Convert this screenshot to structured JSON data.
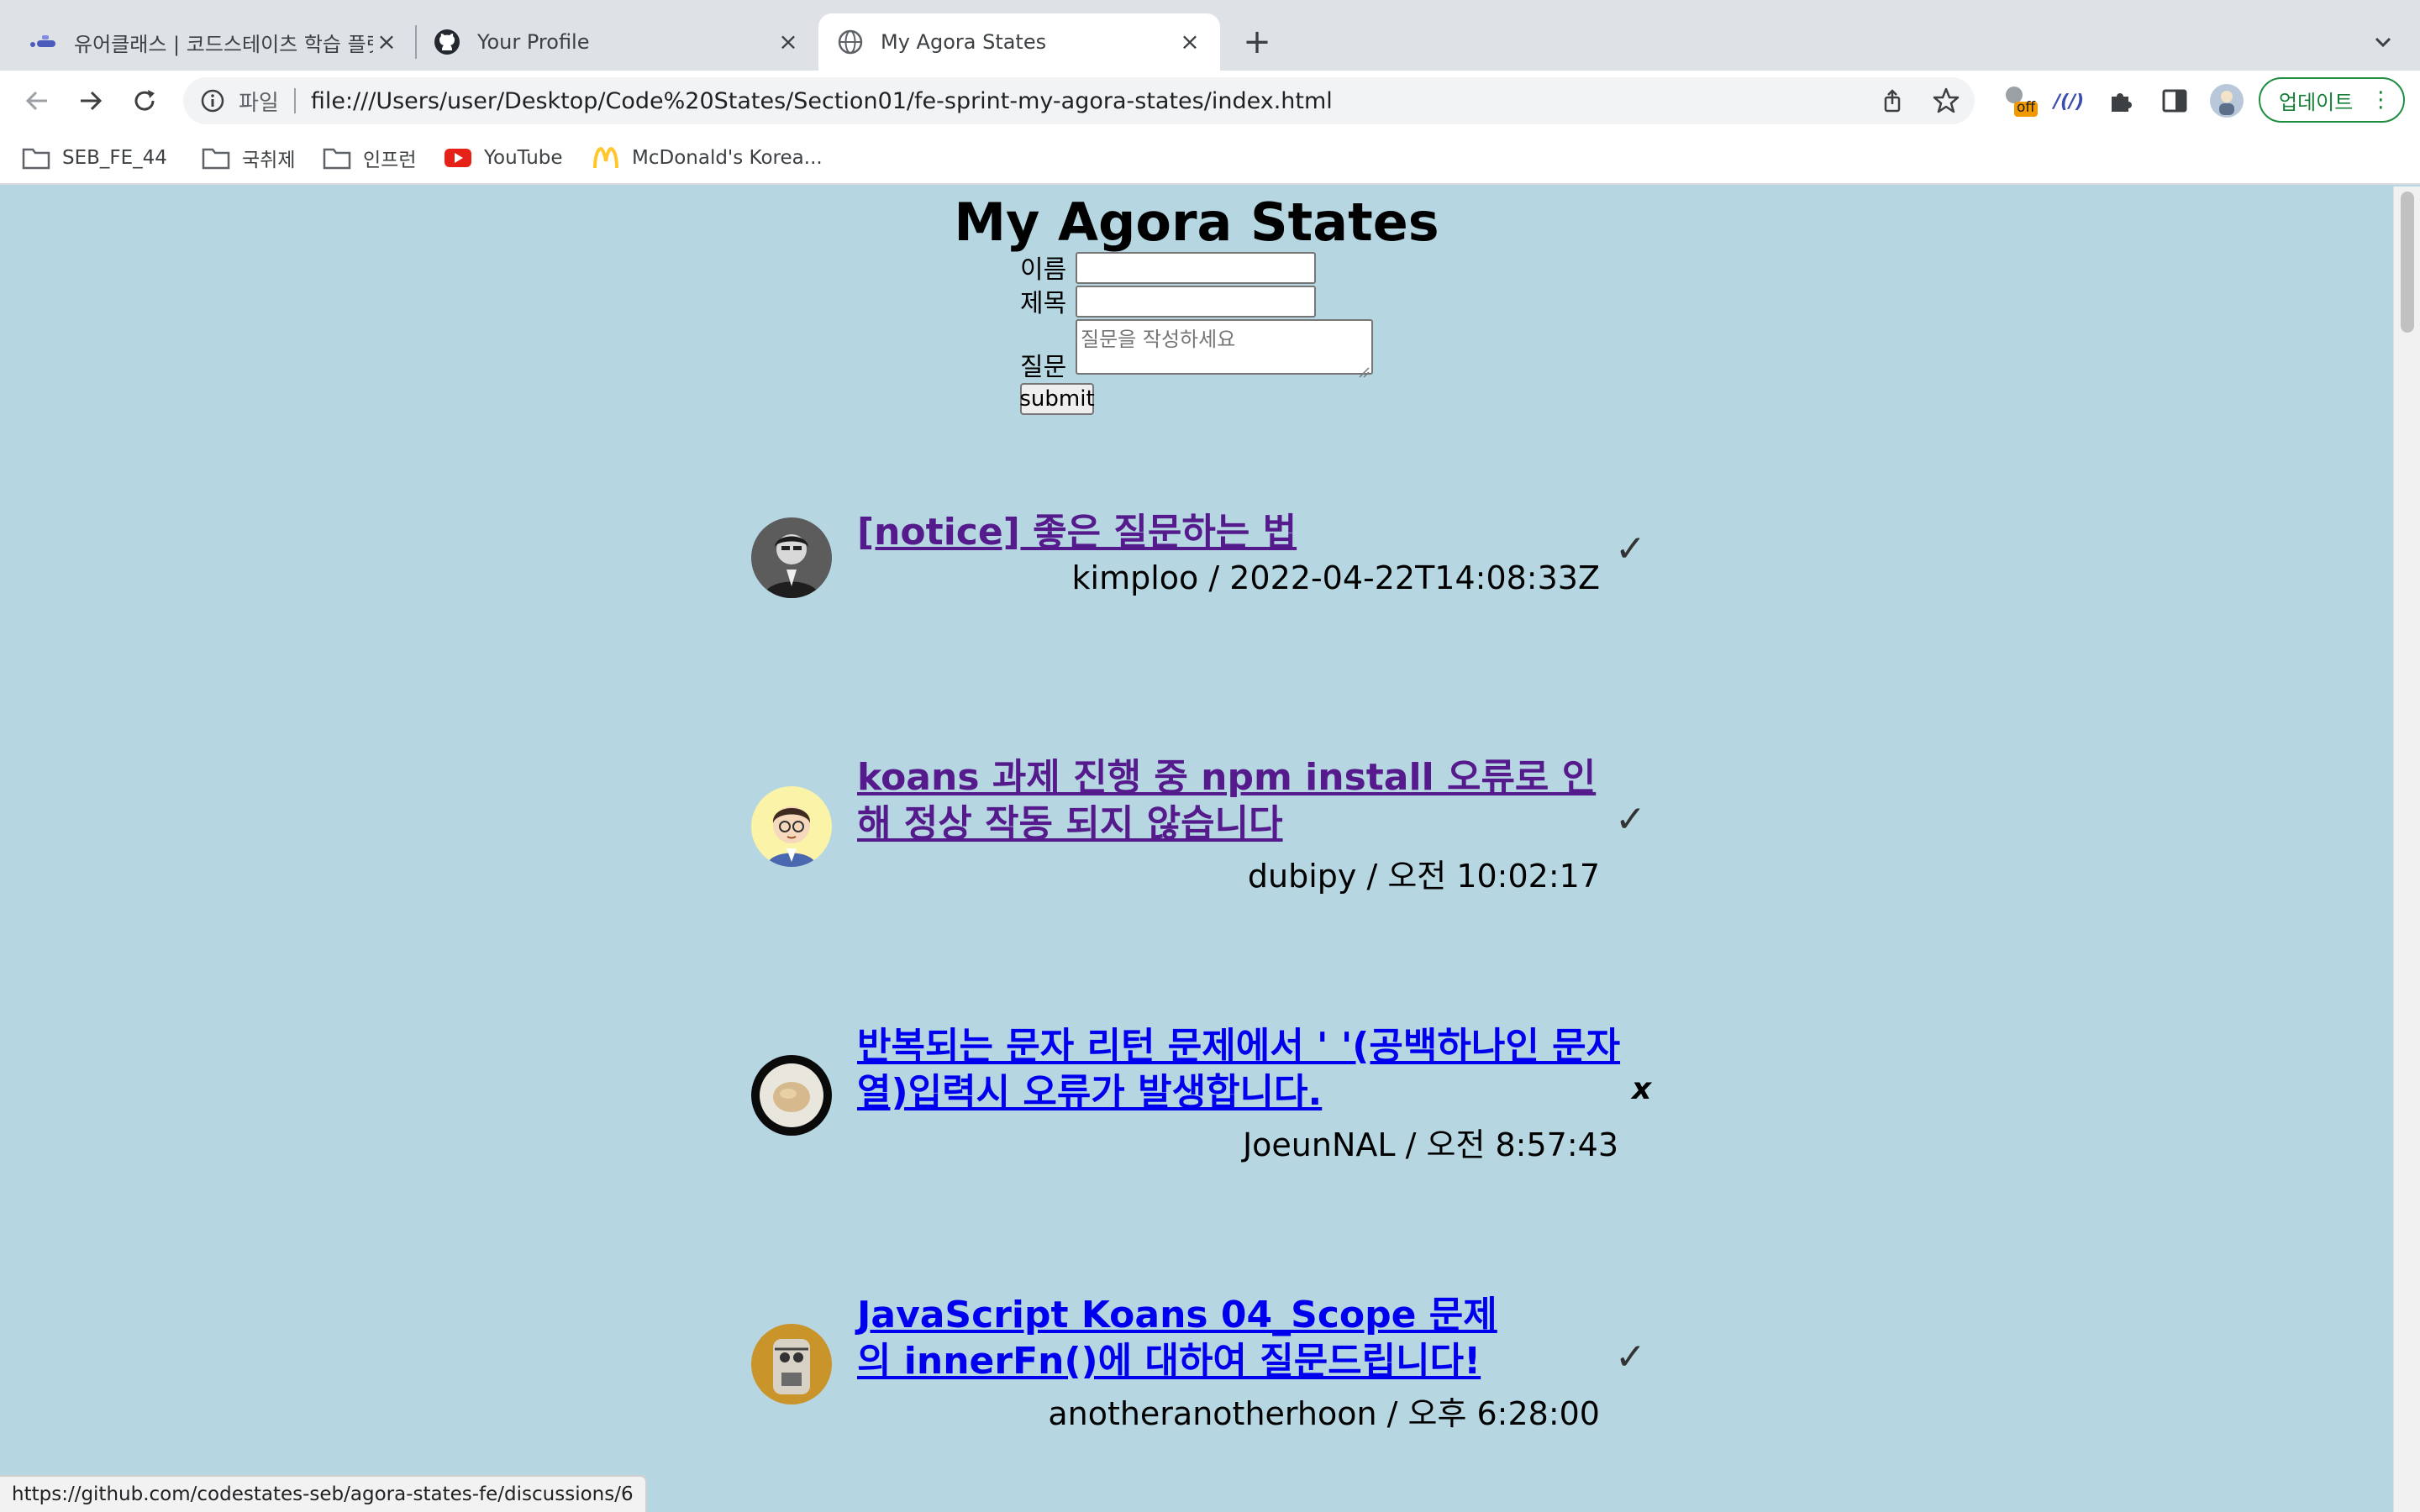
{
  "browser": {
    "tabs": [
      {
        "title": "유어클래스 | 코드스테이츠 학습 플랫폼",
        "icon": "codestates-icon",
        "active": false
      },
      {
        "title": "Your Profile",
        "icon": "github-icon",
        "active": false
      },
      {
        "title": "My Agora States",
        "icon": "globe-icon",
        "active": true
      }
    ],
    "address_scheme": "파일",
    "url": "file:///Users/user/Desktop/Code%20States/Section01/fe-sprint-my-agora-states/index.html",
    "extension_badge": "off",
    "update_label": "업데이트",
    "bookmarks": [
      {
        "label": "SEB_FE_44",
        "icon": "folder-icon"
      },
      {
        "label": "국취제",
        "icon": "folder-icon"
      },
      {
        "label": "인프런",
        "icon": "folder-icon"
      },
      {
        "label": "YouTube",
        "icon": "youtube-icon"
      },
      {
        "label": "McDonald's Korea...",
        "icon": "mcdonalds-icon"
      }
    ],
    "status_url": "https://github.com/codestates-seb/agora-states-fe/discussions/6"
  },
  "page": {
    "title": "My Agora States",
    "form": {
      "name_label": "이름",
      "title_label": "제목",
      "question_label": "질문",
      "question_placeholder": "질문을  작성하세요",
      "submit_label": "submit"
    },
    "discussions": [
      {
        "title": "[notice] 좋은 질문하는 법",
        "author": "kimploo",
        "time": "2022-04-22T14:08:33Z",
        "meta": "kimploo / 2022-04-22T14:08:33Z",
        "answered_mark": "✓",
        "answered": true,
        "visited": true
      },
      {
        "title": "koans 과제 진행 중 npm install 오류로 인해 정상 작동 되지 않습니다",
        "author": "dubipy",
        "time": "오전 10:02:17",
        "meta": "dubipy / 오전 10:02:17",
        "answered_mark": "✓",
        "answered": true,
        "visited": true
      },
      {
        "title": "반복되는 문자 리턴 문제에서 ' '(공백하나인 문자열)입력시 오류가 발생합니다.",
        "author": "JoeunNAL",
        "time": "오전 8:57:43",
        "meta": "JoeunNAL / 오전 8:57:43",
        "answered_mark": "x",
        "answered": false,
        "visited": false
      },
      {
        "title": "JavaScript Koans 04_Scope 문제의 innerFn()에 대하여 질문드립니다!",
        "author": "anotheranotherhoon",
        "time": "오후 6:28:00",
        "meta": "anotheranotherhoon / 오후 6:28:00",
        "answered_mark": "✓",
        "answered": true,
        "visited": false
      }
    ]
  },
  "colors": {
    "page_background": "#b6d7e2",
    "visited_link": "#551a8b",
    "unvisited_link": "#0000ee",
    "update_green": "#188038"
  }
}
